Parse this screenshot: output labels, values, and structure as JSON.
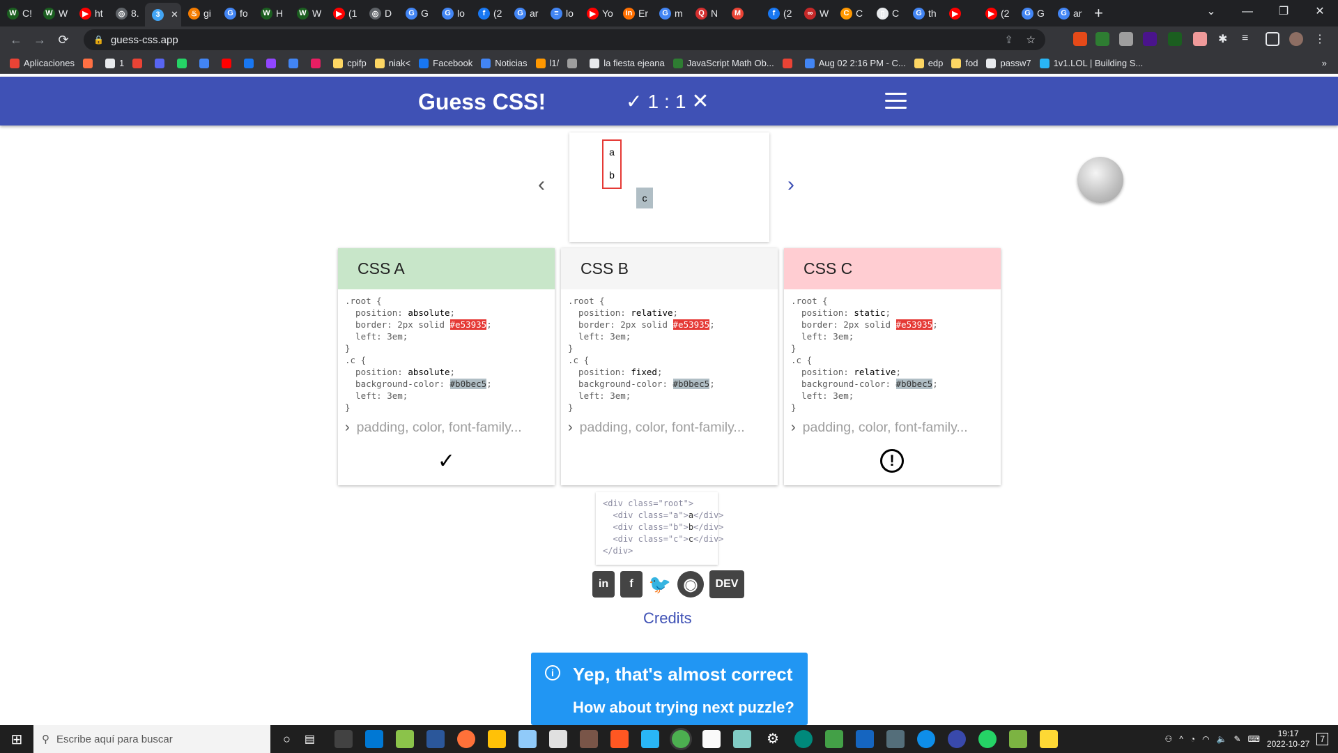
{
  "browser": {
    "tabs": [
      {
        "label": "C!",
        "color": "#1b5e20",
        "glyph": "W"
      },
      {
        "label": "W",
        "color": "#1b5e20",
        "glyph": "W"
      },
      {
        "label": "ht",
        "color": "#ff0000",
        "glyph": "▶"
      },
      {
        "label": "8.",
        "color": "#5f6368",
        "glyph": "◎"
      },
      {
        "label": "",
        "color": "#42a5f5",
        "glyph": "3",
        "active": true
      },
      {
        "label": "gi",
        "color": "#f57c00",
        "glyph": "♨"
      },
      {
        "label": "fo",
        "color": "#4285f4",
        "glyph": "G"
      },
      {
        "label": "H",
        "color": "#1b5e20",
        "glyph": "W"
      },
      {
        "label": "W",
        "color": "#1b5e20",
        "glyph": "W"
      },
      {
        "label": "(1",
        "color": "#ff0000",
        "glyph": "▶"
      },
      {
        "label": "D",
        "color": "#5f6368",
        "glyph": "◎"
      },
      {
        "label": "G",
        "color": "#4285f4",
        "glyph": "G"
      },
      {
        "label": "lo",
        "color": "#4285f4",
        "glyph": "G"
      },
      {
        "label": "(2",
        "color": "#1877f2",
        "glyph": "f"
      },
      {
        "label": "ar",
        "color": "#4285f4",
        "glyph": "G"
      },
      {
        "label": "lo",
        "color": "#4285f4",
        "glyph": "≡"
      },
      {
        "label": "Yo",
        "color": "#ff0000",
        "glyph": "▶"
      },
      {
        "label": "Er",
        "color": "#ff6f00",
        "glyph": "in"
      },
      {
        "label": "m",
        "color": "#4285f4",
        "glyph": "G"
      },
      {
        "label": "N",
        "color": "#d32f2f",
        "glyph": "Q"
      },
      {
        "label": "",
        "color": "#ea4335",
        "glyph": "M"
      },
      {
        "label": "(2",
        "color": "#1877f2",
        "glyph": "f"
      },
      {
        "label": "W",
        "color": "#c62828",
        "glyph": "∞"
      },
      {
        "label": "C",
        "color": "#ff9800",
        "glyph": "C"
      },
      {
        "label": "C",
        "color": "#e8eaed",
        "glyph": "▯"
      },
      {
        "label": "th",
        "color": "#4285f4",
        "glyph": "G"
      },
      {
        "label": "",
        "color": "#ff0000",
        "glyph": "▶"
      },
      {
        "label": "(2",
        "color": "#ff0000",
        "glyph": "▶"
      },
      {
        "label": "G",
        "color": "#4285f4",
        "glyph": "G"
      },
      {
        "label": "ar",
        "color": "#4285f4",
        "glyph": "G"
      }
    ],
    "new_tab": "+",
    "window_controls": {
      "dropdown": "⌄",
      "minimize": "—",
      "restore": "❐",
      "close": "✕"
    },
    "url": "guess-css.app",
    "bookmarks": [
      {
        "label": "Aplicaciones",
        "color": "#ea4335"
      },
      {
        "label": "",
        "color": "#ff7043"
      },
      {
        "label": "1",
        "color": "#e8eaed"
      },
      {
        "label": "",
        "color": "#ea4335"
      },
      {
        "label": "",
        "color": "#5865f2"
      },
      {
        "label": "",
        "color": "#25d366"
      },
      {
        "label": "",
        "color": "#4285f4"
      },
      {
        "label": "",
        "color": "#ff0000"
      },
      {
        "label": "",
        "color": "#1877f2"
      },
      {
        "label": "",
        "color": "#9146ff"
      },
      {
        "label": "",
        "color": "#4285f4"
      },
      {
        "label": "",
        "color": "#e91e63"
      },
      {
        "label": "cpifp",
        "color": "#fdd663"
      },
      {
        "label": "niak<",
        "color": "#fdd663"
      },
      {
        "label": "Facebook",
        "color": "#1877f2"
      },
      {
        "label": "Noticias",
        "color": "#4285f4"
      },
      {
        "label": "l1/",
        "color": "#ff9800"
      },
      {
        "label": "",
        "color": "#9e9e9e"
      },
      {
        "label": "la fiesta ejeana",
        "color": "#e8eaed"
      },
      {
        "label": "JavaScript Math Ob...",
        "color": "#2e7d32"
      },
      {
        "label": "",
        "color": "#ea4335"
      },
      {
        "label": "Aug 02 2:16 PM - C...",
        "color": "#4285f4"
      },
      {
        "label": "edp",
        "color": "#fdd663"
      },
      {
        "label": "fod",
        "color": "#fdd663"
      },
      {
        "label": "passw7",
        "color": "#e8eaed"
      },
      {
        "label": "1v1.LOL | Building S...",
        "color": "#29b6f6"
      }
    ],
    "bookmarks_more": "»"
  },
  "app": {
    "title": "Guess CSS!",
    "score": {
      "correct": "1",
      "separator": ":",
      "wrong": "1"
    },
    "preview": {
      "a": "a",
      "b": "b",
      "c": "c"
    },
    "colors": {
      "header": "#3f51b5",
      "border": "#e53935",
      "bg_c": "#b0bec5"
    },
    "cards": [
      {
        "title": "CSS A",
        "header_color": "#c8e6c9",
        "root_position": "absolute",
        "border_color": "#e53935",
        "root_left": "3em",
        "c_position": "absolute",
        "c_bg": "#b0bec5",
        "c_left": "3em",
        "more": "padding, color, font-family...",
        "status": "✓",
        "status_icon": "check-icon"
      },
      {
        "title": "CSS B",
        "header_color": "#f5f5f5",
        "root_position": "relative",
        "border_color": "#e53935",
        "root_left": "3em",
        "c_position": "fixed",
        "c_bg": "#b0bec5",
        "c_left": "3em",
        "more": "padding, color, font-family...",
        "status": "",
        "status_icon": ""
      },
      {
        "title": "CSS C",
        "header_color": "#ffcdd2",
        "root_position": "static",
        "border_color": "#e53935",
        "root_left": "3em",
        "c_position": "relative",
        "c_bg": "#b0bec5",
        "c_left": "3em",
        "more": "padding, color, font-family...",
        "status": "!",
        "status_icon": "exclamation-circle-icon"
      }
    ],
    "html_snippet": {
      "line1": "<div class=\"root\">",
      "a_open": "  <div class=\"a\">",
      "a_text": "a",
      "a_close": "</div>",
      "b_open": "  <div class=\"b\">",
      "b_text": "b",
      "b_close": "</div>",
      "c_open": "  <div class=\"c\">",
      "c_text": "c",
      "c_close": "</div>",
      "line5": "</div>"
    },
    "social": {
      "linkedin": "in",
      "facebook": "f",
      "twitter": "🐦",
      "github": "◉",
      "dev": "DEV"
    },
    "credits": "Credits",
    "toast": {
      "icon": "i",
      "line1": "Yep, that's almost correct",
      "line2": "How about trying next puzzle?"
    }
  },
  "taskbar": {
    "search_placeholder": "Escribe aquí para buscar",
    "time": "19:17",
    "date": "2022-10-27",
    "notifications": "7"
  }
}
